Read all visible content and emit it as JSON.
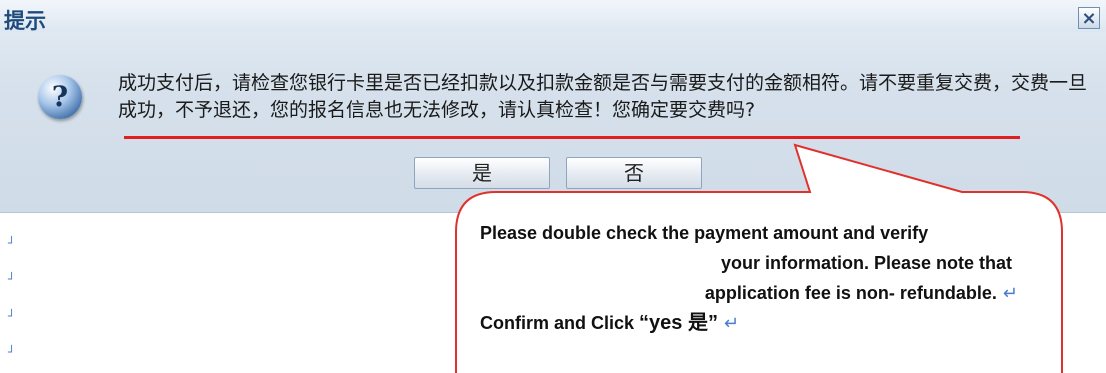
{
  "dialog": {
    "title": "提示",
    "close_glyph": "×",
    "icon": "question-icon",
    "message": "成功支付后，请检查您银行卡里是否已经扣款以及扣款金额是否与需要支付的金额相符。请不要重复交费，交费一旦成功，不予退还，您的报名信息也无法修改，请认真检查！您确定要交费吗?",
    "yes_label": "是",
    "no_label": "否"
  },
  "background": {
    "paragraph_mark": "┘"
  },
  "callout": {
    "line1": "Please double check the payment amount and verify",
    "line2": "your   information.   Please   note   that",
    "line3": "application fee is non- refundable.",
    "line4_prefix": "Confirm and Click  ",
    "line4_quote": "“yes 是”",
    "return_mark": "↵",
    "border_color": "#e0322c"
  }
}
